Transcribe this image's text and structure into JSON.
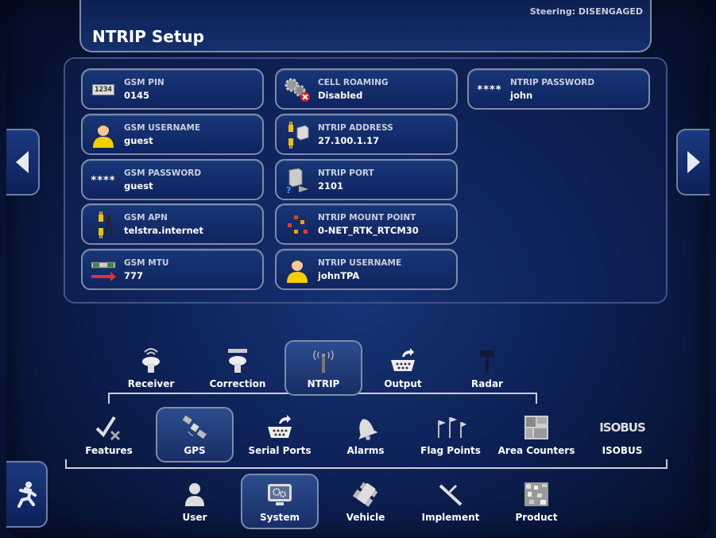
{
  "status": {
    "steering": "Steering: DISENGAGED"
  },
  "header": {
    "title": "NTRIP Setup"
  },
  "settings": {
    "gsm_pin": {
      "label": "GSM PIN",
      "value": "0145"
    },
    "gsm_username": {
      "label": "GSM USERNAME",
      "value": "guest"
    },
    "gsm_password": {
      "label": "GSM PASSWORD",
      "value": "guest",
      "mask": "****"
    },
    "gsm_apn": {
      "label": "GSM APN",
      "value": "telstra.internet"
    },
    "gsm_mtu": {
      "label": "GSM MTU",
      "value": "777"
    },
    "cell_roaming": {
      "label": "CELL ROAMING",
      "value": "Disabled"
    },
    "ntrip_address": {
      "label": "NTRIP ADDRESS",
      "value": "27.100.1.17"
    },
    "ntrip_port": {
      "label": "NTRIP PORT",
      "value": "2101"
    },
    "ntrip_mount_point": {
      "label": "NTRIP MOUNT POINT",
      "value": "0-NET_RTK_RTCM30"
    },
    "ntrip_username": {
      "label": "NTRIP USERNAME",
      "value": "johnTPA"
    },
    "ntrip_password": {
      "label": "NTRIP PASSWORD",
      "value": "john",
      "mask": "****"
    }
  },
  "gps_tabs": {
    "receiver": "Receiver",
    "correction": "Correction",
    "ntrip": "NTRIP",
    "output": "Output",
    "radar": "Radar",
    "selected": "NTRIP"
  },
  "system_tabs": {
    "features": "Features",
    "gps": "GPS",
    "serial_ports": "Serial Ports",
    "alarms": "Alarms",
    "flag_points": "Flag Points",
    "area_counters": "Area Counters",
    "isobus": "ISOBUS",
    "isobus_icon_text": "ISOBUS",
    "selected": "GPS"
  },
  "main_tabs": {
    "user": "User",
    "system": "System",
    "vehicle": "Vehicle",
    "implement": "Implement",
    "product": "Product",
    "selected": "System"
  },
  "pin_icon_text": "1234",
  "colors": {
    "accent_border": "#7d8ba8",
    "tile_bg": "#183677",
    "background": "#0c1c4a"
  }
}
